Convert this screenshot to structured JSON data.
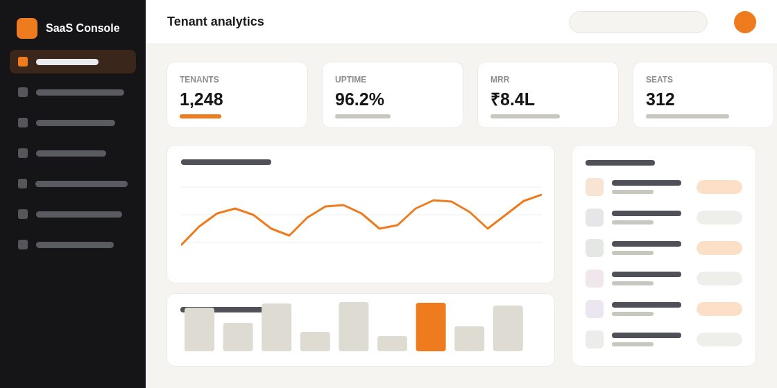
{
  "sidebar": {
    "brand": "SaaS Console",
    "items": [
      {
        "selected": true
      },
      {
        "selected": false
      },
      {
        "selected": false
      },
      {
        "selected": false
      },
      {
        "selected": false
      },
      {
        "selected": false
      },
      {
        "selected": false
      }
    ]
  },
  "header": {
    "title": "Tenant analytics"
  },
  "stats": [
    {
      "label": "TENANTS",
      "value": "1,248",
      "accent": true
    },
    {
      "label": "UPTIME",
      "value": "96.2%",
      "accent": false
    },
    {
      "label": "MRR",
      "value": "₹8.4L",
      "accent": false
    },
    {
      "label": "SEATS",
      "value": "312",
      "accent": false
    }
  ],
  "bars": [
    {
      "highlighted": false
    },
    {
      "highlighted": false
    },
    {
      "highlighted": false
    },
    {
      "highlighted": false
    },
    {
      "highlighted": false
    },
    {
      "highlighted": false
    },
    {
      "highlighted": true
    },
    {
      "highlighted": false
    },
    {
      "highlighted": false
    }
  ],
  "list": [
    {
      "highlighted": true
    },
    {
      "highlighted": false
    },
    {
      "highlighted": true
    },
    {
      "highlighted": false
    },
    {
      "highlighted": true
    },
    {
      "highlighted": false
    }
  ]
}
